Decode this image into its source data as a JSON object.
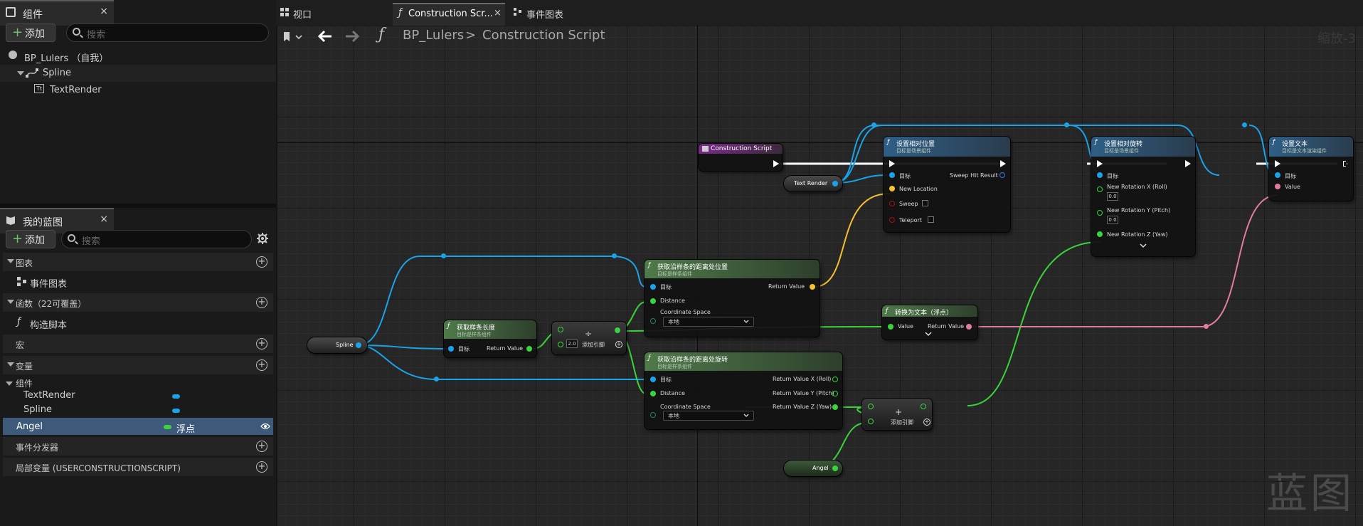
{
  "components_panel": {
    "title": "组件",
    "close": "×",
    "add_label": "添加",
    "search_placeholder": "搜索",
    "tree": [
      {
        "label": "BP_Lulers （自我）"
      },
      {
        "label": "Spline"
      },
      {
        "label": "TextRender"
      }
    ]
  },
  "blueprint_panel": {
    "title": "我的蓝图",
    "close": "×",
    "add_label": "添加",
    "search_placeholder": "搜索",
    "sections": {
      "graphs": "图表",
      "event_graph": "事件图表",
      "functions": "函数（22可覆盖）",
      "construction_script": "构造脚本",
      "macros": "宏",
      "variables": "变量",
      "components_group": "组件",
      "dispatchers": "事件分发器",
      "local_vars": "局部变量 (USERCONSTRUCTIONSCRIPT)"
    },
    "variables": [
      {
        "name": "TextRender",
        "type": "",
        "color": "#1aa3e8"
      },
      {
        "name": "Spline",
        "type": "",
        "color": "#1aa3e8"
      },
      {
        "name": "Angel",
        "type": "浮点",
        "color": "#3bd33b"
      }
    ]
  },
  "graph_tabs": [
    {
      "label": "视口"
    },
    {
      "label": "Construction Scr..."
    },
    {
      "label": "事件图表"
    }
  ],
  "breadcrumb": {
    "blueprint": "BP_Lulers",
    "separator": ">",
    "graph": "Construction Script"
  },
  "zoom_label": "缩放-3",
  "watermark": "蓝图",
  "nodes": {
    "construction_script": {
      "title": "Construction Script"
    },
    "text_render_var": {
      "label": "Text Render"
    },
    "spline_var": {
      "label": "Spline"
    },
    "angel_var": {
      "label": "Angel"
    },
    "set_rel_loc": {
      "title": "设置相对位置",
      "sub": "目标是场景组件",
      "target": "目标",
      "new_location": "New Location",
      "sweep": "Sweep",
      "teleport": "Teleport",
      "sweep_hit": "Sweep Hit Result"
    },
    "set_rel_rot": {
      "title": "设置相对旋转",
      "sub": "目标是场景组件",
      "target": "目标",
      "roll": "New Rotation X (Roll)",
      "pitch": "New Rotation Y (Pitch)",
      "yaw": "New Rotation Z (Yaw)",
      "roll_val": "0.0",
      "pitch_val": "0.0"
    },
    "set_text": {
      "title": "设置文本",
      "sub": "目标是文本渲染组件",
      "target": "目标",
      "value": "Value"
    },
    "get_length": {
      "title": "获取样条长度",
      "sub": "目标是样条组件",
      "target": "目标",
      "ret": "Return Value"
    },
    "divide": {
      "symbol": "÷",
      "val": "2.0",
      "add_pin": "添加引脚"
    },
    "get_loc": {
      "title": "获取沿样条的距离处位置",
      "sub": "目标是样条组件",
      "target": "目标",
      "distance": "Distance",
      "coord": "Coordinate Space",
      "coord_val": "本地",
      "ret": "Return Value"
    },
    "get_rot": {
      "title": "获取沿样条的距离处旋转",
      "sub": "目标是样条组件",
      "target": "目标",
      "distance": "Distance",
      "coord": "Coordinate Space",
      "coord_val": "本地",
      "roll": "Return Value X (Roll)",
      "pitch": "Return Value Y (Pitch)",
      "yaw": "Return Value Z (Yaw)"
    },
    "to_text": {
      "title": "转换为文本（浮点）",
      "value": "Value",
      "ret": "Return Value"
    },
    "add": {
      "symbol": "+",
      "add_pin": "添加引脚"
    }
  },
  "colors": {
    "exec": "#ffffff",
    "object": "#1aa3e8",
    "float": "#3bd33b",
    "vector": "#f5c12e",
    "text": "#e07ca0",
    "struct": "#3a7be0",
    "bool": "#a01515"
  }
}
